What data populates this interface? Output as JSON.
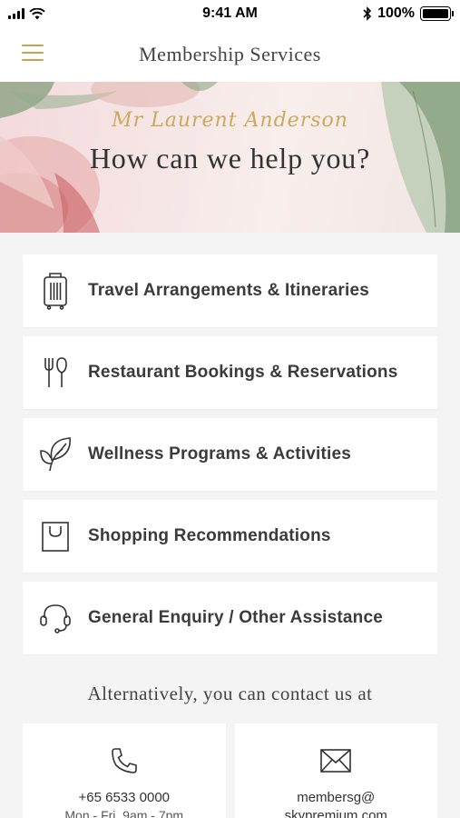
{
  "status_bar": {
    "time": "9:41 AM",
    "battery_text": "100%",
    "battery_level": 1.0,
    "icons": [
      "signal-icon",
      "wifi-icon",
      "bluetooth-icon",
      "battery-icon"
    ]
  },
  "header": {
    "title": "Membership Services",
    "menu_icon": "hamburger-menu-icon",
    "accent_color": "#c9a24e"
  },
  "hero": {
    "member_name": "Mr Laurent Anderson",
    "question": "How can we help you?"
  },
  "services": [
    {
      "label": "Travel Arrangements & Itineraries",
      "icon": "luggage-icon"
    },
    {
      "label": "Restaurant Bookings & Reservations",
      "icon": "cutlery-icon"
    },
    {
      "label": "Wellness Programs & Activities",
      "icon": "leaf-icon"
    },
    {
      "label": "Shopping Recommendations",
      "icon": "shopping-bag-icon"
    },
    {
      "label": "General Enquiry / Other Assistance",
      "icon": "headset-icon"
    }
  ],
  "contact": {
    "heading": "Alternatively, you can contact us at",
    "phone": {
      "number": "+65 6533 0000",
      "hours": "Mon - Fri, 9am - 7pm",
      "icon": "phone-icon"
    },
    "email": {
      "line1": "membersg@",
      "line2": "skypremium.com",
      "icon": "envelope-icon"
    }
  }
}
